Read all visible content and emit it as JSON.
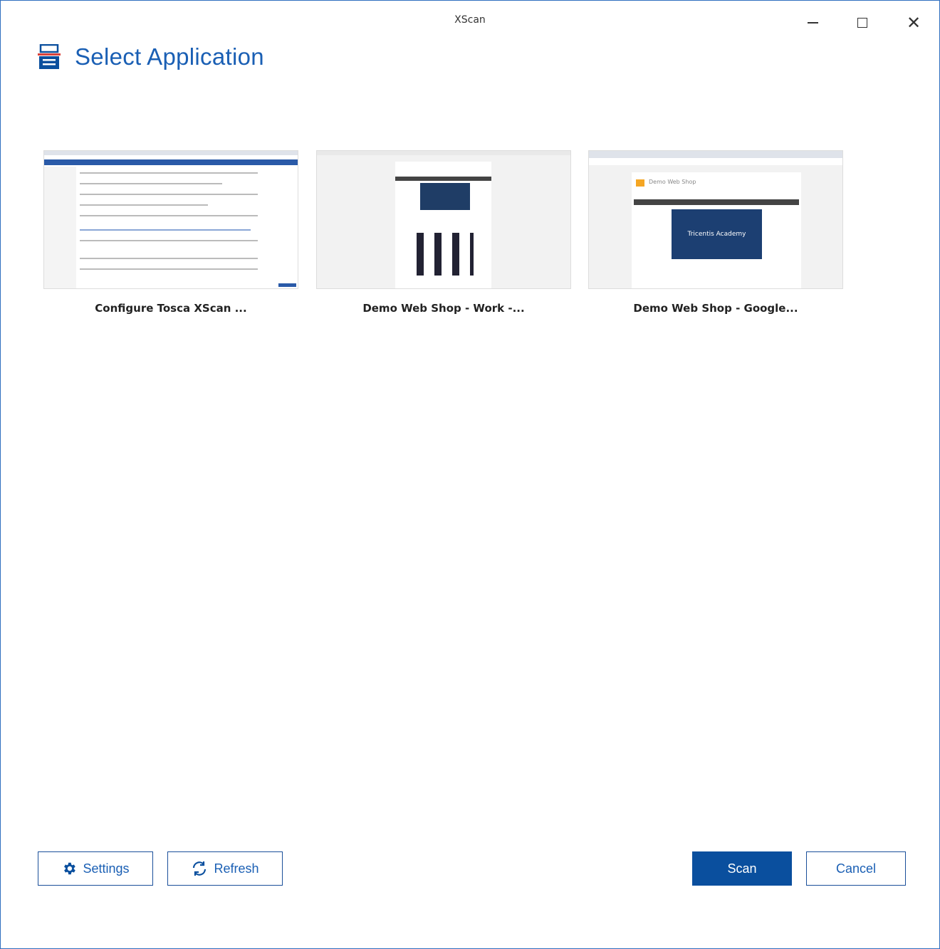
{
  "window": {
    "title": "XScan"
  },
  "header": {
    "title": "Select Application"
  },
  "applications": [
    {
      "label": "Configure Tosca XScan ..."
    },
    {
      "label": "Demo Web Shop - Work -..."
    },
    {
      "label": "Demo Web Shop - Google...",
      "thumb_heading": "Demo Web Shop",
      "thumb_banner": "Tricentis Academy"
    }
  ],
  "buttons": {
    "settings": "Settings",
    "refresh": "Refresh",
    "scan": "Scan",
    "cancel": "Cancel"
  },
  "colors": {
    "accent": "#1a5fb4",
    "primary": "#0a4f9e"
  }
}
